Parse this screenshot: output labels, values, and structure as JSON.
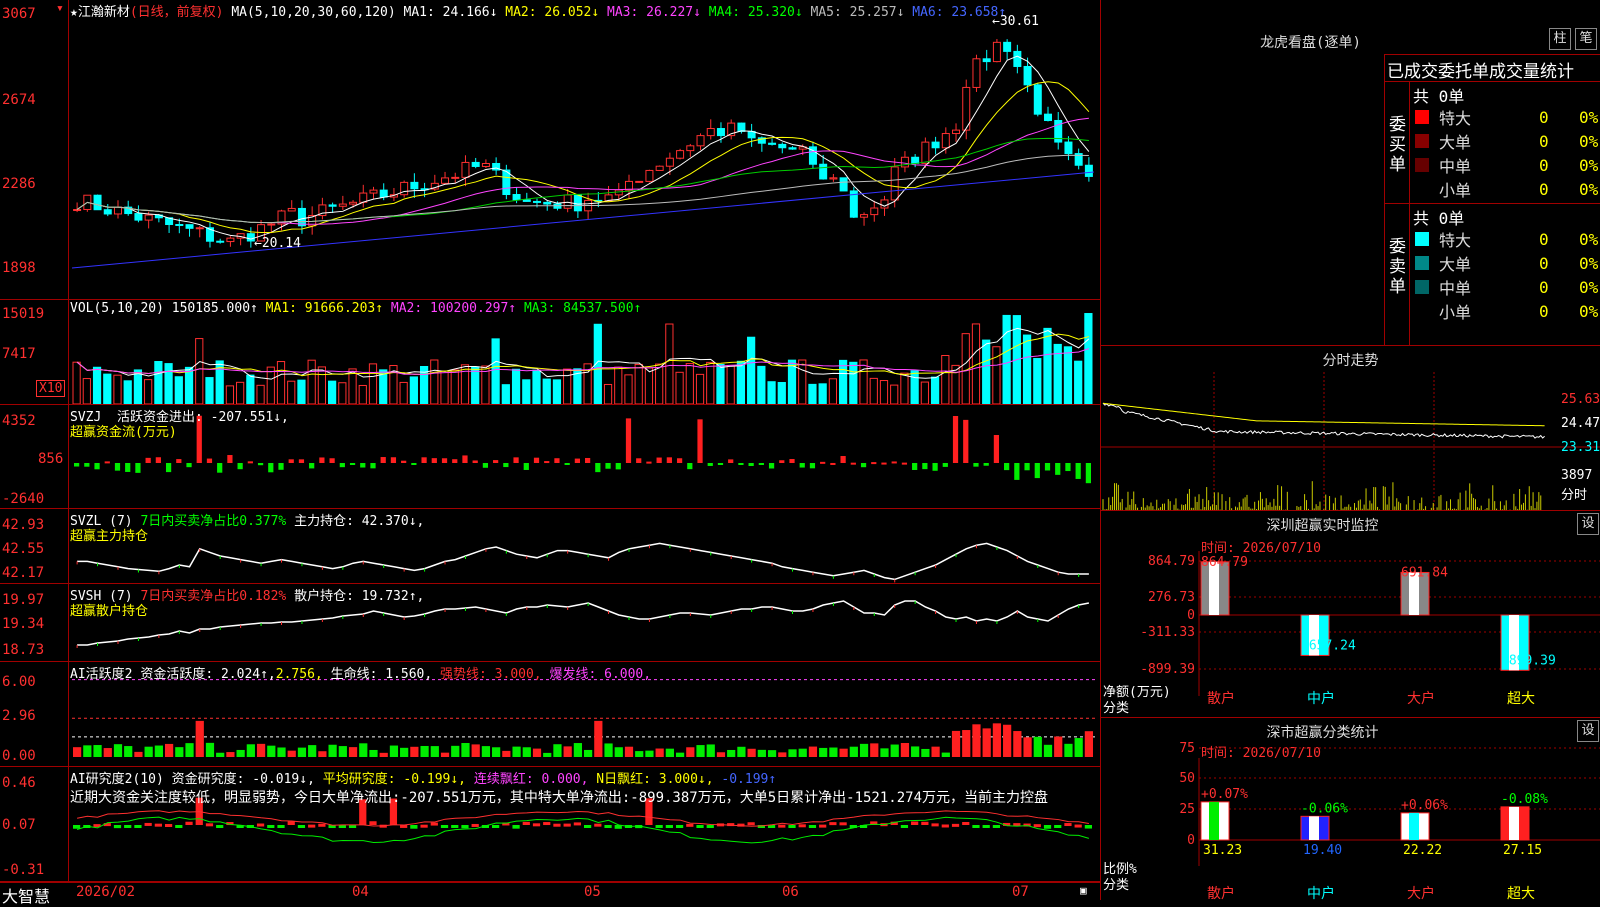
{
  "stock": {
    "star": "★",
    "name": "江瀚新材",
    "mode": "(日线，前复权)"
  },
  "ma_header": {
    "label": "MA(5,10,20,30,60,120)",
    "ma1": "MA1: 24.166↓",
    "ma2": "MA2: 26.052↓",
    "ma3": "MA3: 26.227↓",
    "ma4": "MA4: 25.320↓",
    "ma5": "MA5: 25.257↓",
    "ma6": "MA6: 23.658↑"
  },
  "price_axis": [
    "3067",
    "2674",
    "2286",
    "1898"
  ],
  "price_marks": {
    "high": "30.61",
    "low": "20.14"
  },
  "vol_header": {
    "label": "VOL(5,10,20)",
    "vol": "150185.000↑",
    "ma1": "MA1: 91666.203↑",
    "ma2": "MA2: 100200.297↑",
    "ma3": "MA3: 84537.500↑"
  },
  "vol_axis": [
    "15019",
    "7417"
  ],
  "vol_unit": "X10",
  "svzj": {
    "label": "SVZJ",
    "title": "活跃资金进出: -207.551↓,",
    "sub": "超赢资金流(万元)",
    "axis": [
      "4352",
      "856",
      "-2640"
    ]
  },
  "svzl": {
    "label": "SVZL (7)",
    "ratio": "7日内买卖净占比0.377%",
    "hold": "主力持仓: 42.370↓,",
    "sub": "超赢主力持仓",
    "axis": [
      "42.93",
      "42.55",
      "42.17"
    ]
  },
  "svsh": {
    "label": "SVSH (7)",
    "ratio": "7日内买卖净占比0.182%",
    "hold": "散户持仓: 19.732↑,",
    "sub": "超赢散户持仓",
    "axis": [
      "19.97",
      "19.34",
      "18.73"
    ]
  },
  "ai1": {
    "label": "AI活跃度2",
    "a": "资金活跃度: 2.024↑,",
    "b": "2.756,",
    "c": "生命线: 1.560,",
    "d": "强势线: 3.000,",
    "e": "爆发线: 6.000,",
    "axis": [
      "6.00",
      "2.96",
      "0.00"
    ]
  },
  "ai2": {
    "label": "AI研究度2(10)",
    "a": "资金研究度: -0.019↓,",
    "b": "平均研究度: -0.199↓,",
    "c": "连续飘红: 0.000,",
    "d": "N日飘红: 3.000↓,",
    "e": "-0.199↑",
    "axis": [
      "0.46",
      "0.07",
      "-0.31"
    ],
    "comment": "近期大资金关注度较低，明显弱势，今日大单净流出:-207.551万元，其中特大单净流出:-899.387万元，大单5日累计净出-1521.274万元，当前主力控盘"
  },
  "date_axis": [
    "2026/02",
    "04",
    "05",
    "06",
    "07"
  ],
  "brand": "大智慧",
  "lhb": {
    "title": "龙虎看盘(逐单)",
    "btn1": "柱",
    "btn2": "笔",
    "tabs": "已成交委托单成交量统计",
    "buy": {
      "side": "委买单",
      "total": "共 0单",
      "rows": [
        {
          "name": "特大",
          "v": "0",
          "p": "0%",
          "c": "#ff0000"
        },
        {
          "name": "大单",
          "v": "0",
          "p": "0%",
          "c": "#880000"
        },
        {
          "name": "中单",
          "v": "0",
          "p": "0%",
          "c": "#660000"
        },
        {
          "name": "小单",
          "v": "0",
          "p": "0%",
          "c": "#000000"
        }
      ]
    },
    "sell": {
      "side": "委卖单",
      "total": "共 0单",
      "rows": [
        {
          "name": "特大",
          "v": "0",
          "p": "0%",
          "c": "#00ffff"
        },
        {
          "name": "大单",
          "v": "0",
          "p": "0%",
          "c": "#008888"
        },
        {
          "name": "中单",
          "v": "0",
          "p": "0%",
          "c": "#006666"
        },
        {
          "name": "小单",
          "v": "0",
          "p": "0%",
          "c": "#000000"
        }
      ]
    }
  },
  "intraday": {
    "title": "分时走势",
    "axis": [
      "25.63",
      "24.47",
      "23.31"
    ],
    "vol": "3897",
    "unit": "分时"
  },
  "sz_monitor": {
    "title": "深圳超赢实时监控",
    "btn": "设",
    "date": "时间: 2026/07/10",
    "axis": [
      "864.79",
      "276.73",
      "0",
      "-311.33",
      "-899.39"
    ],
    "ylabel": "净额(万元)",
    "xlabel": "分类",
    "bars": [
      {
        "cat": "散户",
        "v": 864.79,
        "label": "864.79"
      },
      {
        "cat": "中户",
        "v": -657.24,
        "label": "-657.24"
      },
      {
        "cat": "大户",
        "v": 691.84,
        "label": "691.84"
      },
      {
        "cat": "超大",
        "v": -899.39,
        "label": "-899.39"
      }
    ]
  },
  "sz_class": {
    "title": "深市超赢分类统计",
    "btn": "设",
    "date": "时间: 2026/07/10",
    "axis": [
      "75",
      "50",
      "25",
      "0"
    ],
    "ylabel": "比例%",
    "xlabel": "分类",
    "bars": [
      {
        "cat": "散户",
        "v": 31.23,
        "label": "31.23",
        "chg": "+0.07%"
      },
      {
        "cat": "中户",
        "v": 19.4,
        "label": "19.40",
        "chg": "-0.06%"
      },
      {
        "cat": "大户",
        "v": 22.22,
        "label": "22.22",
        "chg": "+0.06%"
      },
      {
        "cat": "超大",
        "v": 27.15,
        "label": "27.15",
        "chg": "-0.08%"
      }
    ]
  },
  "chart_data": [
    {
      "type": "bar",
      "title": "",
      "categories": [
        "散户",
        "中户",
        "大户",
        "超大"
      ],
      "values": [
        864.79,
        -657.24,
        691.84,
        -899.39
      ],
      "ylim": [
        -899.39,
        864.79
      ]
    },
    {
      "type": "bar",
      "title": "",
      "categories": [
        "散户",
        "中户",
        "大户",
        "超大"
      ],
      "values": [
        31.23,
        19.4,
        22.22,
        27.15
      ],
      "ylim": [
        0,
        75
      ]
    }
  ]
}
